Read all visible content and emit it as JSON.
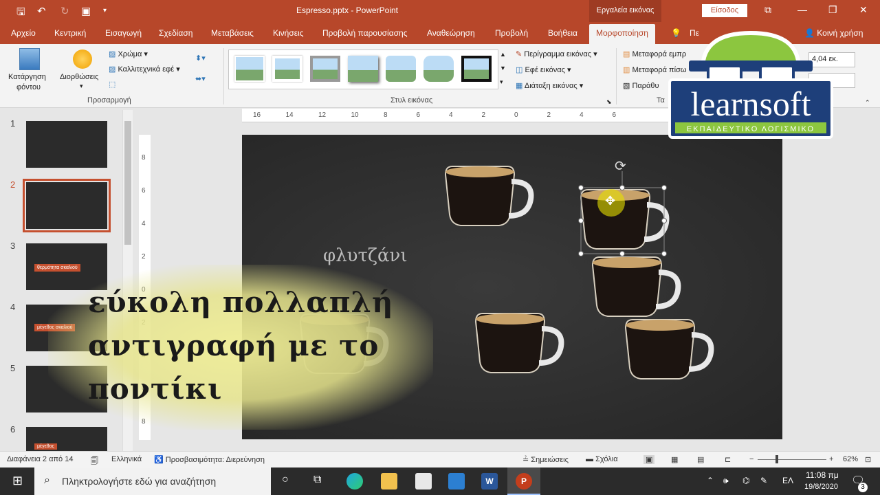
{
  "titlebar": {
    "title": "Espresso.pptx - PowerPoint",
    "context_tab": "Εργαλεία εικόνας",
    "signin": "Είσοδος"
  },
  "tabs": [
    "Αρχείο",
    "Κεντρική",
    "Εισαγωγή",
    "Σχεδίαση",
    "Μεταβάσεις",
    "Κινήσεις",
    "Προβολή παρουσίασης",
    "Αναθεώρηση",
    "Προβολή",
    "Βοήθεια",
    "Μορφοποίηση"
  ],
  "tell_me": "Πε",
  "share": "Κοινή χρήση",
  "ribbon": {
    "remove_bg": "Κατάργηση",
    "remove_bg2": "φόντου",
    "corrections": "Διορθώσεις",
    "color": "Χρώμα",
    "artistic": "Καλλιτεχνικά εφέ",
    "group_adjust": "Προσαρμογή",
    "group_styles": "Στυλ εικόνας",
    "border": "Περίγραμμα εικόνας",
    "effects": "Εφέ εικόνας",
    "layout": "Διάταξη εικόνας",
    "bring_forward": "Μεταφορά εμπρ",
    "send_back": "Μεταφορά πίσω",
    "selection": "Παράθυ",
    "group_arrange": "Τα",
    "height": "4,04 εκ."
  },
  "slides": {
    "numbers": [
      "1",
      "2",
      "3",
      "4",
      "5",
      "6"
    ],
    "thumb3_label": "θερμότητα σκαλιού",
    "thumb4_label": "μέγεθος σκαλιού",
    "thumb6_label": "μέγεθος"
  },
  "slide": {
    "word": "φλυτζάνι"
  },
  "overlay": {
    "caption": "εύκολη πολλαπλή\nαντιγραφή με το\nποντίκι"
  },
  "logo": {
    "brand": "learnsoft",
    "tagline": "ΕΚΠΑΙΔΕΥΤΙΚΟ ΛΟΓΙΣΜΙΚΟ"
  },
  "ruler": {
    "h": [
      "16",
      "14",
      "12",
      "10",
      "8",
      "6",
      "4",
      "2",
      "0",
      "2",
      "4",
      "6"
    ],
    "v": [
      "8",
      "6",
      "4",
      "2",
      "0",
      "2",
      "4",
      "6",
      "8"
    ]
  },
  "status": {
    "slide": "Διαφάνεια 2 από 14",
    "lang": "Ελληνικά",
    "access": "Προσβασιμότητα: Διερεύνηση",
    "notes": "Σημειώσεις",
    "comments": "Σχόλια",
    "zoom": "62%"
  },
  "taskbar": {
    "search": "Πληκτρολογήστε εδώ για αναζήτηση",
    "lang": "ΕΛ",
    "time": "11:08 πμ",
    "date": "19/8/2020",
    "notif": "3"
  }
}
